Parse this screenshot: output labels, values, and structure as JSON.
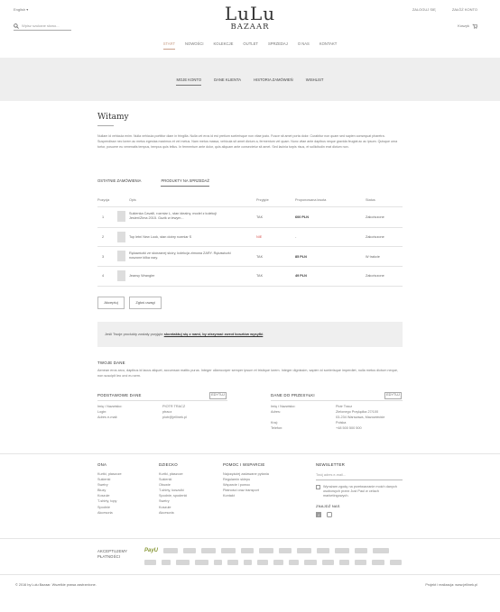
{
  "header": {
    "language": "English",
    "login": "ZALOGUJ SIĘ",
    "account": "ZAŁÓŻ KONTO",
    "logo_top": "LuLu",
    "logo_bottom": "BAZAAR",
    "search_placeholder": "Wpisz szukane słowo...",
    "cart_label": "Koszyk"
  },
  "main_nav": [
    "START",
    "NOWOŚCI",
    "KOLEKCJE",
    "OUTLET",
    "SPRZEDAJ",
    "O NAS",
    "KONTAKT"
  ],
  "sub_nav": [
    "MOJE KONTO",
    "DANE KLIENTA",
    "HISTORIA ZAMÓWIEŃ",
    "WISHLIST"
  ],
  "welcome": {
    "title": "Witamy",
    "text": "Nullam id vehicula enim. Nulla vehicula porttitor diam in fringilla. Nulla vel eros id est pretium scelerisque non vitae justo. Fusce sit amet porta dolor. Curabitur non quam sed sapien consequat pharetra. Suspendisse nec lorem ac metus egestas maximus et vel metus. Nam metus massa, vehicula sit amet dictum a, fermentum vel quam. Nunc vitae ante dapibus neque gravida feugiat ac ac ipsum. Quisque urna tortor, posuere eu venenatis tempus, tempus quis tellus. In fermentum ante dolor, quis aliquam ante consectetur sit amet. Sed lacinia turpis risus, et sollicitudin erat dictum non."
  },
  "order_tabs": [
    "OSTATNIE ZAMÓWIENIA",
    "PRODUKTY NA SPRZEDAŻ"
  ],
  "table": {
    "headers": [
      "Pozycja",
      "Opis",
      "Przyjęte",
      "Proponowana kwota",
      "Status"
    ],
    "rows": [
      {
        "pos": "1",
        "desc": "Sukienka Cavalli, rozmiar L, stan idealny, model z kolekcji Jesień/Zima 2015. Guzik w lewym...",
        "accepted": "TAK",
        "price": "600 PLN",
        "status": "Zakończone"
      },
      {
        "pos": "2",
        "desc": "Top letni New Look, stan dobry rozmiar S",
        "accepted": "NIE",
        "price": "-",
        "status": "Zakończone"
      },
      {
        "pos": "3",
        "desc": "Rękawiczki ze skórzanej skóry, kolekcja zimowa ZARY. Rękawiczki noszone kilka razy.",
        "accepted": "TAK",
        "price": "85 PLN",
        "status": "W trakcie"
      },
      {
        "pos": "4",
        "desc": "Jeansy Wrangler",
        "accepted": "TAK",
        "price": "49 PLN",
        "status": "Zakończone"
      }
    ]
  },
  "buttons": {
    "accept": "Akceptuj",
    "reject": "Zgłoś uwagi"
  },
  "note": {
    "before": "Jeśli Twoje produkty zostały przyjęte ",
    "link": "skontaktuj się z nami, by otrzymać zwrot kosztów wysyłki",
    "after": "."
  },
  "your_data": {
    "title": "TWOJE DANE",
    "text": "Aenean eros arcu, dapibus id lacus aliquet, accumsan mattis purus. Integer ullamcorper semper ipsum et tristique lorem. Integer dignissim, sapien id scelerisque imperdiet, nulla metus dictum neque, non suscipit leo orci eu sem."
  },
  "basic": {
    "title": "PODSTAWOWE DANE",
    "edit": "EDYTUJ",
    "labels": [
      "Imię i Nazwisko:",
      "Login:",
      "Adres e-mail:"
    ],
    "values": [
      "PIOTR TRACZ",
      "ptracz",
      "piotr@jellinek.pl"
    ]
  },
  "shipping": {
    "title": "DANE DO PRZESYŁKI",
    "edit": "EDYTUJ",
    "labels": [
      "Imię i Nazwisko:",
      "Adres:",
      "",
      "Kraj:",
      "Telefon:"
    ],
    "values": [
      "Piotr Tracz",
      "Zielonego Przylądka 27/100",
      "03-234 Warszawa, Mazowieckie",
      "Polska",
      "+48 500 500 500"
    ]
  },
  "footer": {
    "cols": [
      {
        "title": "ONA",
        "items": [
          "Kurtki, płaszcze",
          "Sukienki",
          "Swetry",
          "Bluzy",
          "Koszule",
          "T-shirty, topy",
          "Spodnie",
          "Akcesoria"
        ]
      },
      {
        "title": "DZIECKO",
        "items": [
          "Kurtki, płaszcze",
          "Sukienki",
          "Obuwie",
          "T-shirty, koszulki",
          "Spodnie, spodenki",
          "Swetry",
          "Koszule",
          "Akcesoria"
        ]
      },
      {
        "title": "POMOC I WSPARCIE",
        "items": [
          "Najczęściej zadawane pytania",
          "Regulamin sklepu",
          "Wsparcie i pomoc",
          "Płatności oraz transport",
          "Kontakt"
        ]
      }
    ],
    "newsletter": {
      "title": "NEWSLETTER",
      "placeholder": "Twój adres e-mail...",
      "consent": "Wyrażam zgodę na przetwarzanie moich danych osobowych przez Just Paul w celach marketingowych."
    },
    "find_us": "ZNAJDŹ NAS",
    "payments_title": "AKCEPTUJEMY PŁATNOŚCI",
    "payment_logo": "PayU",
    "copyright": "© 2016 by Lulu Bazaar. Wszelkie prawa zastrzeżone.",
    "project": "Projekt i realizacja: www.jellinek.pl"
  },
  "colors": {
    "accent": "#c9a08a",
    "band": "#eeeeee",
    "no": "#d9534f"
  }
}
